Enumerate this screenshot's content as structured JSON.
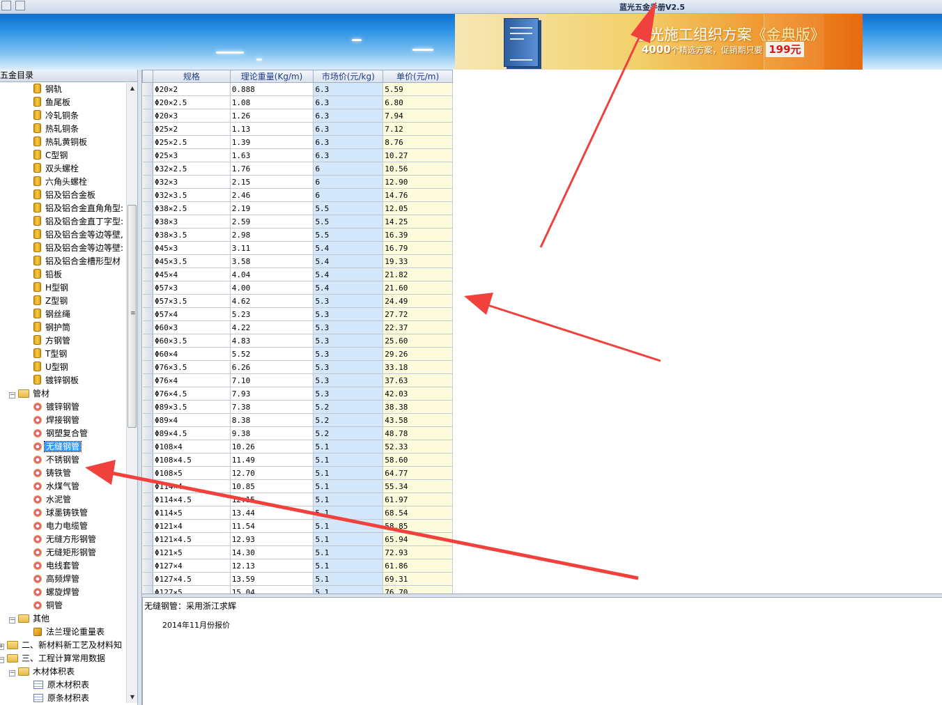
{
  "window": {
    "title": "蓝光五金手册V2.5"
  },
  "ad": {
    "headline": "蓝光施工组织方案",
    "headline_tag": "《金典版》",
    "count": "4000",
    "subline": "个精选方案，促销期只要",
    "price": "199元"
  },
  "left_panel": {
    "header": "五金目录"
  },
  "tree": {
    "items": [
      {
        "label": "钢轨",
        "icon": "db-icon",
        "depth": 2
      },
      {
        "label": "鱼尾板",
        "icon": "db-icon",
        "depth": 2
      },
      {
        "label": "冷轧铜条",
        "icon": "db-icon",
        "depth": 2
      },
      {
        "label": "热轧铜条",
        "icon": "db-icon",
        "depth": 2
      },
      {
        "label": "热轧黄铜板",
        "icon": "db-icon",
        "depth": 2
      },
      {
        "label": "C型钢",
        "icon": "db-icon",
        "depth": 2
      },
      {
        "label": "双头螺栓",
        "icon": "db-icon",
        "depth": 2
      },
      {
        "label": "六角头螺栓",
        "icon": "db-icon",
        "depth": 2
      },
      {
        "label": "铝及铝合金板",
        "icon": "db-icon",
        "depth": 2
      },
      {
        "label": "铝及铝合金直角角型:",
        "icon": "db-icon",
        "depth": 2
      },
      {
        "label": "铝及铝合金直丁字型:",
        "icon": "db-icon",
        "depth": 2
      },
      {
        "label": "铝及铝合金等边等壁,",
        "icon": "db-icon",
        "depth": 2
      },
      {
        "label": "铝及铝合金等边等壁:",
        "icon": "db-icon",
        "depth": 2
      },
      {
        "label": "铝及铝合金槽形型材",
        "icon": "db-icon",
        "depth": 2
      },
      {
        "label": "铅板",
        "icon": "db-icon",
        "depth": 2
      },
      {
        "label": "H型钢",
        "icon": "db-icon",
        "depth": 2
      },
      {
        "label": "Z型钢",
        "icon": "db-icon",
        "depth": 2
      },
      {
        "label": "钢丝绳",
        "icon": "db-icon",
        "depth": 2
      },
      {
        "label": "钢护筒",
        "icon": "db-icon",
        "depth": 2
      },
      {
        "label": "方钢管",
        "icon": "db-icon",
        "depth": 2
      },
      {
        "label": "T型钢",
        "icon": "db-icon",
        "depth": 2
      },
      {
        "label": "U型钢",
        "icon": "db-icon",
        "depth": 2
      },
      {
        "label": "镀锌钢板",
        "icon": "db-icon",
        "depth": 2
      },
      {
        "label": "管材",
        "icon": "folder-icon",
        "depth": 1,
        "expander": "⊟"
      },
      {
        "label": "镀锌钢管",
        "icon": "disk-icon",
        "depth": 2
      },
      {
        "label": "焊接钢管",
        "icon": "disk-icon",
        "depth": 2
      },
      {
        "label": "钢塑复合管",
        "icon": "disk-icon",
        "depth": 2
      },
      {
        "label": "无缝钢管",
        "icon": "disk-icon",
        "depth": 2,
        "selected": true
      },
      {
        "label": "不锈钢管",
        "icon": "disk-icon",
        "depth": 2
      },
      {
        "label": "铸铁管",
        "icon": "disk-icon",
        "depth": 2
      },
      {
        "label": "水煤气管",
        "icon": "disk-icon",
        "depth": 2
      },
      {
        "label": "水泥管",
        "icon": "disk-icon",
        "depth": 2
      },
      {
        "label": "球墨铸铁管",
        "icon": "disk-icon",
        "depth": 2
      },
      {
        "label": "电力电缆管",
        "icon": "disk-icon",
        "depth": 2
      },
      {
        "label": "无缝方形钢管",
        "icon": "disk-icon",
        "depth": 2
      },
      {
        "label": "无缝矩形钢管",
        "icon": "disk-icon",
        "depth": 2
      },
      {
        "label": "电线套管",
        "icon": "disk-icon",
        "depth": 2
      },
      {
        "label": "高频焊管",
        "icon": "disk-icon",
        "depth": 2
      },
      {
        "label": "螺旋焊管",
        "icon": "disk-icon",
        "depth": 2
      },
      {
        "label": "铜管",
        "icon": "disk-icon",
        "depth": 2
      },
      {
        "label": "其他",
        "icon": "folder-icon",
        "depth": 1,
        "expander": "⊟"
      },
      {
        "label": "法兰理论重量表",
        "icon": "pin-icon",
        "depth": 2
      },
      {
        "label": "二、新材料新工艺及材料知",
        "icon": "folder-icon",
        "depth": 0,
        "expander": "⊞"
      },
      {
        "label": "三、工程计算常用数据",
        "icon": "folder-icon",
        "depth": 0,
        "expander": "⊟"
      },
      {
        "label": "木材体积表",
        "icon": "folder-icon",
        "depth": 1,
        "expander": "⊟"
      },
      {
        "label": "原木材积表",
        "icon": "table-icon",
        "depth": 2
      },
      {
        "label": "原条材积表",
        "icon": "table-icon",
        "depth": 2
      }
    ]
  },
  "table": {
    "columns": [
      "规格",
      "理论重量(Kg/m)",
      "市场价(元/kg)",
      "单价(元/m)"
    ],
    "rows": [
      [
        "Φ20×2",
        "0.888",
        "6.3",
        "5.59"
      ],
      [
        "Φ20×2.5",
        "1.08",
        "6.3",
        "6.80"
      ],
      [
        "Φ20×3",
        "1.26",
        "6.3",
        "7.94"
      ],
      [
        "Φ25×2",
        "1.13",
        "6.3",
        "7.12"
      ],
      [
        "Φ25×2.5",
        "1.39",
        "6.3",
        "8.76"
      ],
      [
        "Φ25×3",
        "1.63",
        "6.3",
        "10.27"
      ],
      [
        "Φ32×2.5",
        "1.76",
        "6",
        "10.56"
      ],
      [
        "Φ32×3",
        "2.15",
        "6",
        "12.90"
      ],
      [
        "Φ32×3.5",
        "2.46",
        "6",
        "14.76"
      ],
      [
        "Φ38×2.5",
        "2.19",
        "5.5",
        "12.05"
      ],
      [
        "Φ38×3",
        "2.59",
        "5.5",
        "14.25"
      ],
      [
        "Φ38×3.5",
        "2.98",
        "5.5",
        "16.39"
      ],
      [
        "Φ45×3",
        "3.11",
        "5.4",
        "16.79"
      ],
      [
        "Φ45×3.5",
        "3.58",
        "5.4",
        "19.33"
      ],
      [
        "Φ45×4",
        "4.04",
        "5.4",
        "21.82"
      ],
      [
        "Φ57×3",
        "4.00",
        "5.4",
        "21.60"
      ],
      [
        "Φ57×3.5",
        "4.62",
        "5.3",
        "24.49"
      ],
      [
        "Φ57×4",
        "5.23",
        "5.3",
        "27.72"
      ],
      [
        "Φ60×3",
        "4.22",
        "5.3",
        "22.37"
      ],
      [
        "Φ60×3.5",
        "4.83",
        "5.3",
        "25.60"
      ],
      [
        "Φ60×4",
        "5.52",
        "5.3",
        "29.26"
      ],
      [
        "Φ76×3.5",
        "6.26",
        "5.3",
        "33.18"
      ],
      [
        "Φ76×4",
        "7.10",
        "5.3",
        "37.63"
      ],
      [
        "Φ76×4.5",
        "7.93",
        "5.3",
        "42.03"
      ],
      [
        "Φ89×3.5",
        "7.38",
        "5.2",
        "38.38"
      ],
      [
        "Φ89×4",
        "8.38",
        "5.2",
        "43.58"
      ],
      [
        "Φ89×4.5",
        "9.38",
        "5.2",
        "48.78"
      ],
      [
        "Φ108×4",
        "10.26",
        "5.1",
        "52.33"
      ],
      [
        "Φ108×4.5",
        "11.49",
        "5.1",
        "58.60"
      ],
      [
        "Φ108×5",
        "12.70",
        "5.1",
        "64.77"
      ],
      [
        "Φ114×4",
        "10.85",
        "5.1",
        "55.34"
      ],
      [
        "Φ114×4.5",
        "12.15",
        "5.1",
        "61.97"
      ],
      [
        "Φ114×5",
        "13.44",
        "5.1",
        "68.54"
      ],
      [
        "Φ121×4",
        "11.54",
        "5.1",
        "58.85"
      ],
      [
        "Φ121×4.5",
        "12.93",
        "5.1",
        "65.94"
      ],
      [
        "Φ121×5",
        "14.30",
        "5.1",
        "72.93"
      ],
      [
        "Φ127×4",
        "12.13",
        "5.1",
        "61.86"
      ],
      [
        "Φ127×4.5",
        "13.59",
        "5.1",
        "69.31"
      ],
      [
        "Φ127×5",
        "15.04",
        "5.1",
        "76.70"
      ]
    ]
  },
  "detail": {
    "line1": "无缝钢管：采用浙江求辉",
    "line2": "2014年11月份报价"
  },
  "colors": {
    "annotation_arrow": "#f0413c",
    "selection": "#3399ff",
    "market_price_column": "#d4e7fb",
    "unit_price_column": "#fcfbdc"
  }
}
